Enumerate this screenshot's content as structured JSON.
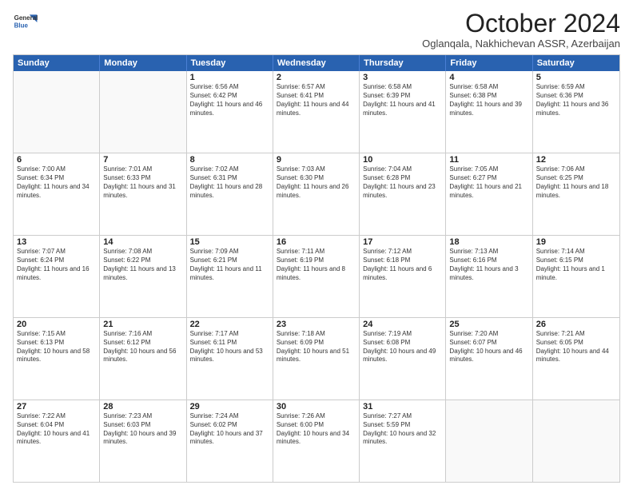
{
  "header": {
    "logo_line1": "General",
    "logo_line2": "Blue",
    "month": "October 2024",
    "location": "Oglanqala, Nakhichevan ASSR, Azerbaijan"
  },
  "days_of_week": [
    "Sunday",
    "Monday",
    "Tuesday",
    "Wednesday",
    "Thursday",
    "Friday",
    "Saturday"
  ],
  "weeks": [
    [
      {
        "day": "",
        "info": ""
      },
      {
        "day": "",
        "info": ""
      },
      {
        "day": "1",
        "info": "Sunrise: 6:56 AM\nSunset: 6:42 PM\nDaylight: 11 hours and 46 minutes."
      },
      {
        "day": "2",
        "info": "Sunrise: 6:57 AM\nSunset: 6:41 PM\nDaylight: 11 hours and 44 minutes."
      },
      {
        "day": "3",
        "info": "Sunrise: 6:58 AM\nSunset: 6:39 PM\nDaylight: 11 hours and 41 minutes."
      },
      {
        "day": "4",
        "info": "Sunrise: 6:58 AM\nSunset: 6:38 PM\nDaylight: 11 hours and 39 minutes."
      },
      {
        "day": "5",
        "info": "Sunrise: 6:59 AM\nSunset: 6:36 PM\nDaylight: 11 hours and 36 minutes."
      }
    ],
    [
      {
        "day": "6",
        "info": "Sunrise: 7:00 AM\nSunset: 6:34 PM\nDaylight: 11 hours and 34 minutes."
      },
      {
        "day": "7",
        "info": "Sunrise: 7:01 AM\nSunset: 6:33 PM\nDaylight: 11 hours and 31 minutes."
      },
      {
        "day": "8",
        "info": "Sunrise: 7:02 AM\nSunset: 6:31 PM\nDaylight: 11 hours and 28 minutes."
      },
      {
        "day": "9",
        "info": "Sunrise: 7:03 AM\nSunset: 6:30 PM\nDaylight: 11 hours and 26 minutes."
      },
      {
        "day": "10",
        "info": "Sunrise: 7:04 AM\nSunset: 6:28 PM\nDaylight: 11 hours and 23 minutes."
      },
      {
        "day": "11",
        "info": "Sunrise: 7:05 AM\nSunset: 6:27 PM\nDaylight: 11 hours and 21 minutes."
      },
      {
        "day": "12",
        "info": "Sunrise: 7:06 AM\nSunset: 6:25 PM\nDaylight: 11 hours and 18 minutes."
      }
    ],
    [
      {
        "day": "13",
        "info": "Sunrise: 7:07 AM\nSunset: 6:24 PM\nDaylight: 11 hours and 16 minutes."
      },
      {
        "day": "14",
        "info": "Sunrise: 7:08 AM\nSunset: 6:22 PM\nDaylight: 11 hours and 13 minutes."
      },
      {
        "day": "15",
        "info": "Sunrise: 7:09 AM\nSunset: 6:21 PM\nDaylight: 11 hours and 11 minutes."
      },
      {
        "day": "16",
        "info": "Sunrise: 7:11 AM\nSunset: 6:19 PM\nDaylight: 11 hours and 8 minutes."
      },
      {
        "day": "17",
        "info": "Sunrise: 7:12 AM\nSunset: 6:18 PM\nDaylight: 11 hours and 6 minutes."
      },
      {
        "day": "18",
        "info": "Sunrise: 7:13 AM\nSunset: 6:16 PM\nDaylight: 11 hours and 3 minutes."
      },
      {
        "day": "19",
        "info": "Sunrise: 7:14 AM\nSunset: 6:15 PM\nDaylight: 11 hours and 1 minute."
      }
    ],
    [
      {
        "day": "20",
        "info": "Sunrise: 7:15 AM\nSunset: 6:13 PM\nDaylight: 10 hours and 58 minutes."
      },
      {
        "day": "21",
        "info": "Sunrise: 7:16 AM\nSunset: 6:12 PM\nDaylight: 10 hours and 56 minutes."
      },
      {
        "day": "22",
        "info": "Sunrise: 7:17 AM\nSunset: 6:11 PM\nDaylight: 10 hours and 53 minutes."
      },
      {
        "day": "23",
        "info": "Sunrise: 7:18 AM\nSunset: 6:09 PM\nDaylight: 10 hours and 51 minutes."
      },
      {
        "day": "24",
        "info": "Sunrise: 7:19 AM\nSunset: 6:08 PM\nDaylight: 10 hours and 49 minutes."
      },
      {
        "day": "25",
        "info": "Sunrise: 7:20 AM\nSunset: 6:07 PM\nDaylight: 10 hours and 46 minutes."
      },
      {
        "day": "26",
        "info": "Sunrise: 7:21 AM\nSunset: 6:05 PM\nDaylight: 10 hours and 44 minutes."
      }
    ],
    [
      {
        "day": "27",
        "info": "Sunrise: 7:22 AM\nSunset: 6:04 PM\nDaylight: 10 hours and 41 minutes."
      },
      {
        "day": "28",
        "info": "Sunrise: 7:23 AM\nSunset: 6:03 PM\nDaylight: 10 hours and 39 minutes."
      },
      {
        "day": "29",
        "info": "Sunrise: 7:24 AM\nSunset: 6:02 PM\nDaylight: 10 hours and 37 minutes."
      },
      {
        "day": "30",
        "info": "Sunrise: 7:26 AM\nSunset: 6:00 PM\nDaylight: 10 hours and 34 minutes."
      },
      {
        "day": "31",
        "info": "Sunrise: 7:27 AM\nSunset: 5:59 PM\nDaylight: 10 hours and 32 minutes."
      },
      {
        "day": "",
        "info": ""
      },
      {
        "day": "",
        "info": ""
      }
    ]
  ]
}
